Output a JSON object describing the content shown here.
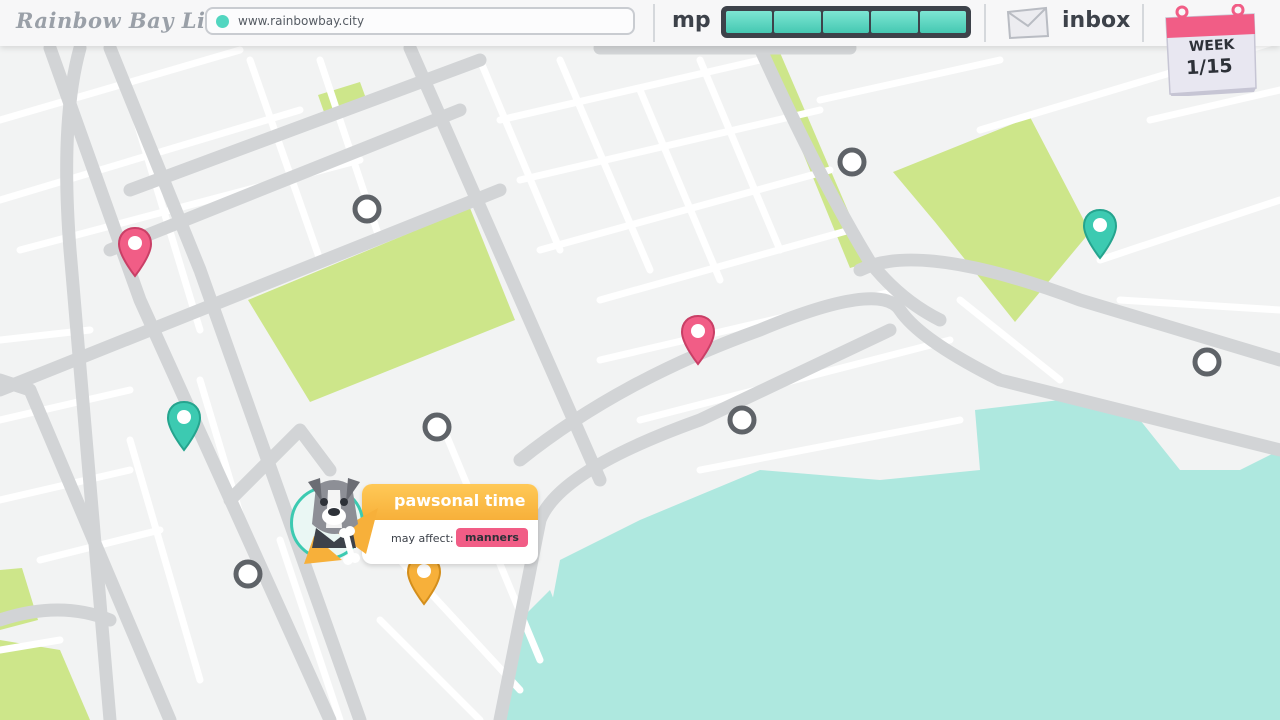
{
  "app": {
    "title": "Rainbow Bay Live",
    "url": "www.rainbowbay.city"
  },
  "hud": {
    "mp_label": "mp",
    "mp_segments_total": 5,
    "mp_segments_filled": 5,
    "inbox_label": "inbox",
    "week_label": "WEEK",
    "week_value": "1/15"
  },
  "popup": {
    "title": "pawsonal time",
    "affect_label": "may affect:",
    "affect_badge": "manners",
    "avatar": "dog-portrait"
  },
  "map": {
    "pins": [
      {
        "color": "pink",
        "icon": "location-pin-icon"
      },
      {
        "color": "pink",
        "icon": "location-pin-icon"
      },
      {
        "color": "teal",
        "icon": "location-pin-icon"
      },
      {
        "color": "teal",
        "icon": "location-pin-icon"
      },
      {
        "color": "orange",
        "icon": "location-pin-icon"
      }
    ],
    "points_of_interest": 7
  },
  "colors": {
    "pink": "#f15d86",
    "teal": "#3ccab1",
    "orange": "#f7b03a",
    "park": "#cde68a",
    "water": "#aee8df",
    "road": "#d2d4d6",
    "mp_fill": "#45c8b2"
  }
}
